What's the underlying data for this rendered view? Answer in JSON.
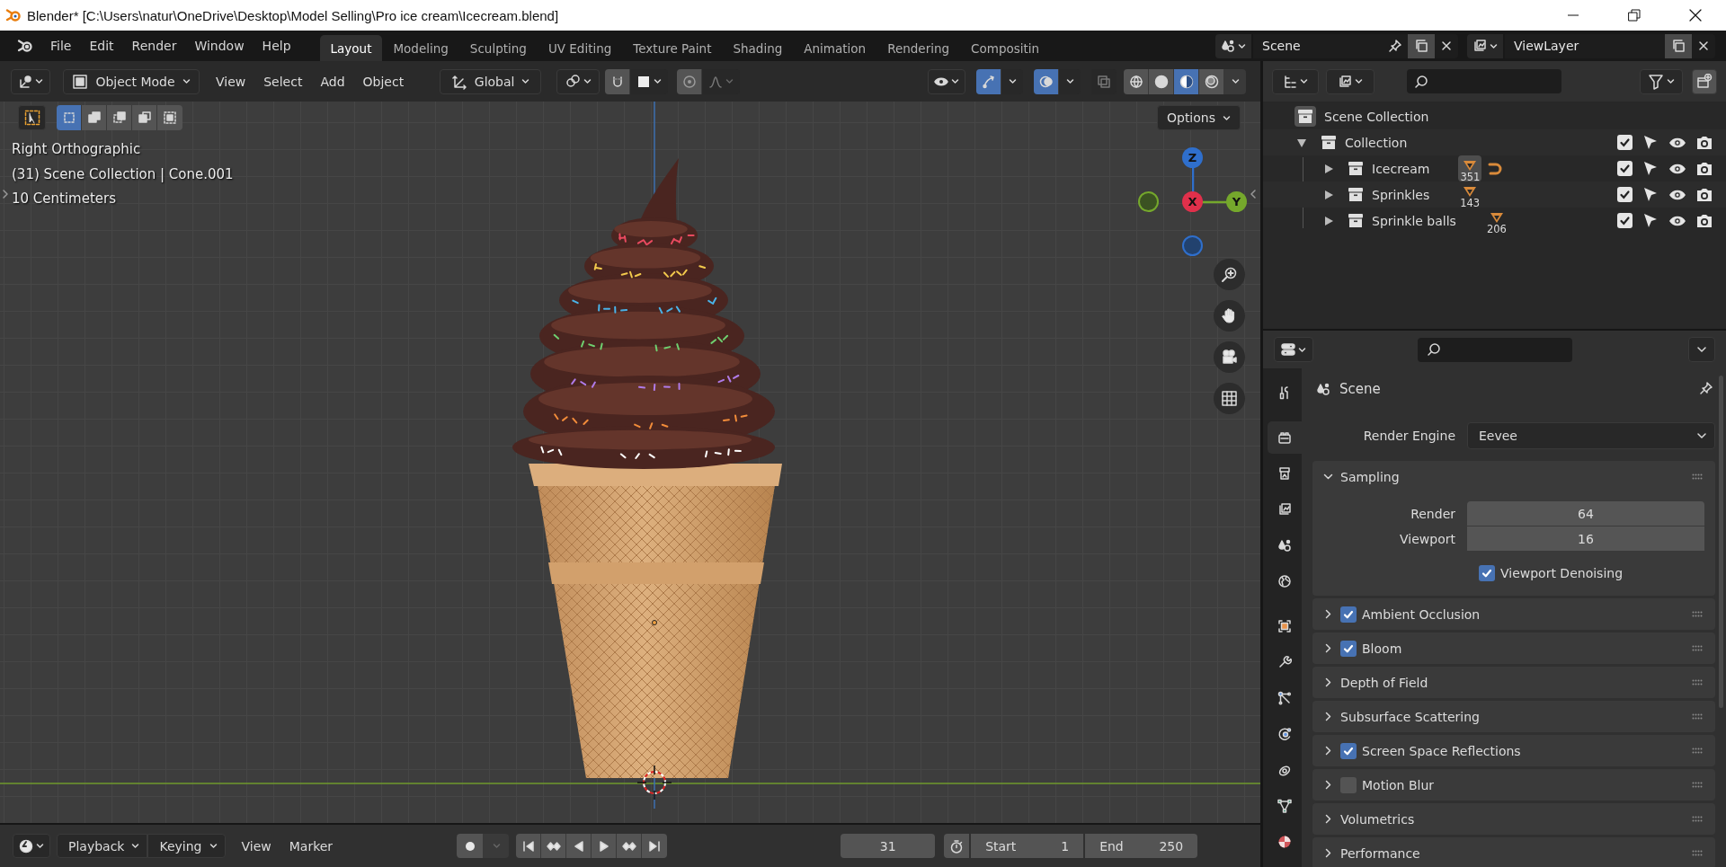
{
  "window": {
    "title": "Blender* [C:\\Users\\natur\\OneDrive\\Desktop\\Model Selling\\Pro ice cream\\Icecream.blend]"
  },
  "menu": [
    "File",
    "Edit",
    "Render",
    "Window",
    "Help"
  ],
  "workspaces": [
    {
      "label": "Layout",
      "selected": true
    },
    {
      "label": "Modeling",
      "selected": false
    },
    {
      "label": "Sculpting",
      "selected": false
    },
    {
      "label": "UV Editing",
      "selected": false
    },
    {
      "label": "Texture Paint",
      "selected": false
    },
    {
      "label": "Shading",
      "selected": false
    },
    {
      "label": "Animation",
      "selected": false
    },
    {
      "label": "Rendering",
      "selected": false
    },
    {
      "label": "Compositin",
      "selected": false
    }
  ],
  "scene": {
    "name": "Scene"
  },
  "view_layer": {
    "name": "ViewLayer"
  },
  "viewport": {
    "mode": "Object Mode",
    "menus": [
      "View",
      "Select",
      "Add",
      "Object"
    ],
    "orientation": "Global",
    "gizmos_on": true,
    "overlays_on": true,
    "xray": false,
    "shading_modes": [
      {
        "selected": false
      },
      {
        "selected": false
      },
      {
        "selected": true
      },
      {
        "selected": false
      }
    ],
    "select_modes": [
      {
        "selected": true
      },
      {
        "selected": false
      },
      {
        "selected": false
      },
      {
        "selected": false
      },
      {
        "selected": false
      }
    ],
    "options": "Options",
    "info": [
      "Right Orthographic",
      "(31) Scene Collection | Cone.001",
      "10 Centimeters"
    ],
    "axes": [
      {
        "label": "Z",
        "color": "#2f6fcc"
      },
      {
        "label": "X",
        "color": "#e0304b"
      },
      {
        "label": "Y",
        "color": "#75a82c"
      }
    ]
  },
  "timeline": {
    "menus": [
      {
        "label": "Playback",
        "kind": "dropdown"
      },
      {
        "label": "Keying",
        "kind": "dropdown"
      },
      {
        "label": "View",
        "kind": "menu"
      },
      {
        "label": "Marker",
        "kind": "menu"
      }
    ],
    "current_frame": "31",
    "start": {
      "label": "Start",
      "value": "1"
    },
    "end": {
      "label": "End",
      "value": "250"
    }
  },
  "outliner": {
    "root": {
      "label": "Scene Collection",
      "children": [
        {
          "label": "Collection",
          "expanded": true,
          "checked": true,
          "children": [
            {
              "label": "Icecream",
              "expanded": false,
              "checked": true,
              "count": "351",
              "active": true,
              "curve": true
            },
            {
              "label": "Sprinkles",
              "expanded": false,
              "checked": true,
              "count": "143",
              "active": false,
              "curve": false
            },
            {
              "label": "Sprinkle balls",
              "expanded": false,
              "checked": true,
              "count": "206",
              "active": false,
              "curve": false
            }
          ]
        }
      ]
    }
  },
  "properties": {
    "tabs": [
      {
        "selected": false
      },
      {
        "selected": true
      },
      {
        "selected": false
      },
      {
        "selected": false
      },
      {
        "selected": false
      },
      {
        "selected": false
      },
      {
        "selected": false
      },
      {
        "selected": false
      },
      {
        "selected": false
      },
      {
        "selected": false
      },
      {
        "selected": false
      },
      {
        "selected": false
      },
      {
        "selected": false
      }
    ],
    "context": "Scene",
    "engine": {
      "label": "Render Engine",
      "value": "Eevee"
    },
    "panels": [
      {
        "title": "Sampling",
        "kind": "plain",
        "expanded": true,
        "fields": [
          {
            "label": "Render",
            "value": "64"
          },
          {
            "label": "Viewport",
            "value": "16"
          }
        ],
        "options": [
          {
            "label": "Viewport Denoising",
            "checked": true
          }
        ]
      },
      {
        "title": "Ambient Occlusion",
        "kind": "toggle",
        "checked": true,
        "expanded": false
      },
      {
        "title": "Bloom",
        "kind": "toggle",
        "checked": true,
        "expanded": false
      },
      {
        "title": "Depth of Field",
        "kind": "plain",
        "expanded": false
      },
      {
        "title": "Subsurface Scattering",
        "kind": "plain",
        "expanded": false
      },
      {
        "title": "Screen Space Reflections",
        "kind": "toggle",
        "checked": true,
        "expanded": false
      },
      {
        "title": "Motion Blur",
        "kind": "toggle",
        "checked": false,
        "expanded": false
      },
      {
        "title": "Volumetrics",
        "kind": "plain",
        "expanded": false
      },
      {
        "title": "Performance",
        "kind": "plain",
        "expanded": false
      }
    ]
  }
}
